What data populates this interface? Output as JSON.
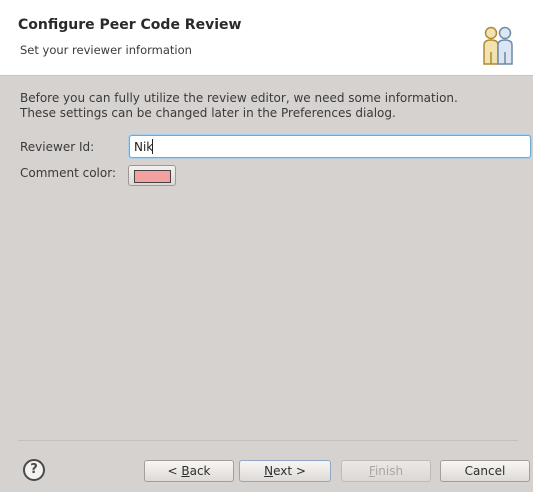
{
  "dialog": {
    "title": "Configure Peer Code Review",
    "subtitle": "Set your reviewer information"
  },
  "description": {
    "line1": "Before you can fully utilize the review editor, we need some information.",
    "line2": "These settings can be changed later in the Preferences dialog."
  },
  "form": {
    "reviewer_id_label": "Reviewer Id:",
    "reviewer_id_value": "Nik",
    "comment_color_label": "Comment color:",
    "comment_color": "#f2a0a0"
  },
  "buttons": {
    "help": "?",
    "back_prefix": "< ",
    "back_mnemonic": "B",
    "back_rest": "ack",
    "next_mnemonic": "N",
    "next_rest": "ext >",
    "finish_mnemonic": "F",
    "finish_rest": "inish",
    "cancel": "Cancel"
  },
  "icons": {
    "header_image": "people-icon",
    "help": "help-icon"
  }
}
